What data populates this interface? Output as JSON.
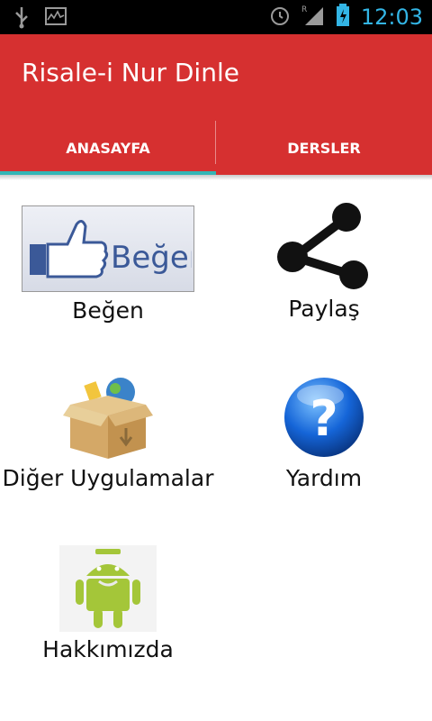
{
  "status_bar": {
    "time": "12:03"
  },
  "app_bar": {
    "title": "Risale-i Nur Dinle"
  },
  "tabs": [
    {
      "label": "ANASAYFA",
      "active": true
    },
    {
      "label": "DERSLER",
      "active": false
    }
  ],
  "grid": [
    {
      "label": "Beğen",
      "icon": "like-icon",
      "icon_text": "Beğen"
    },
    {
      "label": "Paylaş",
      "icon": "share-icon"
    },
    {
      "label": "Diğer Uygulamalar",
      "icon": "box-icon"
    },
    {
      "label": "Yardım",
      "icon": "help-icon",
      "icon_text": "?"
    },
    {
      "label": "Hakkımızda",
      "icon": "android-icon"
    }
  ],
  "colors": {
    "app_bar": "#d63030",
    "tab_indicator": "#33b5b5",
    "status_accent": "#33b5e5"
  }
}
